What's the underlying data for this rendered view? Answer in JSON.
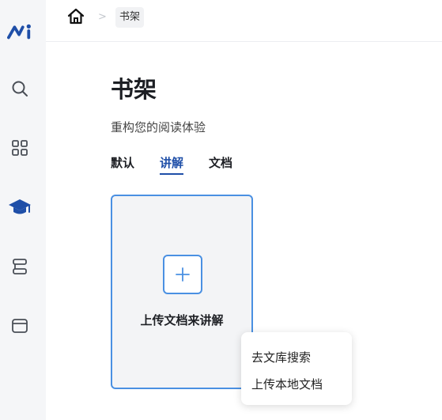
{
  "app": {
    "logo_icon": "brand-logo"
  },
  "sidebar": {
    "items": [
      {
        "name": "search",
        "icon": "search-icon"
      },
      {
        "name": "apps",
        "icon": "grid-icon"
      },
      {
        "name": "courses",
        "icon": "graduation-cap-icon",
        "active": true
      },
      {
        "name": "stack",
        "icon": "layers-icon"
      },
      {
        "name": "window",
        "icon": "window-icon"
      }
    ]
  },
  "breadcrumb": {
    "home_icon": "home-icon",
    "separator": ">",
    "current": "书架"
  },
  "page": {
    "title": "书架",
    "subtitle": "重构您的阅读体验"
  },
  "tabs": [
    {
      "label": "默认",
      "active": false
    },
    {
      "label": "讲解",
      "active": true
    },
    {
      "label": "文档",
      "active": false
    }
  ],
  "upload_card": {
    "icon": "plus-icon",
    "label": "上传文档来讲解"
  },
  "dropdown_menu": {
    "items": [
      "去文库搜索",
      "上传本地文档"
    ]
  },
  "colors": {
    "accent": "#1f4fa8",
    "card_border": "#4a90e2"
  }
}
